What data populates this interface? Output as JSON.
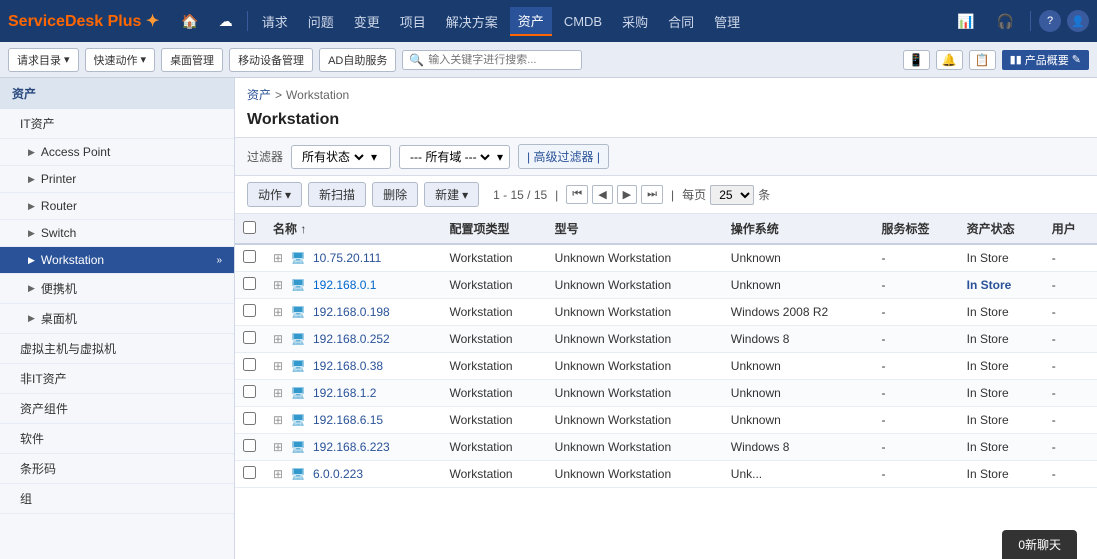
{
  "app": {
    "name": "ServiceDesk",
    "name2": "Plus",
    "logo_mark": "✦"
  },
  "topnav": {
    "icons": [
      "🏠",
      "☁",
      ""
    ],
    "items": [
      "请求",
      "问题",
      "变更",
      "项目",
      "解决方案",
      "资产",
      "CMDB",
      "采购",
      "合同",
      "管理",
      "📊",
      "🎧"
    ],
    "active": "资产",
    "right_icons": [
      "?",
      "👤"
    ]
  },
  "toolbar": {
    "btn1": "请求目录",
    "btn2": "快速动作",
    "btn3": "桌面管理",
    "btn4": "移动设备管理",
    "btn5": "AD自助服务",
    "search_placeholder": "输入关键字进行搜索...",
    "product_label": "产品概要",
    "icons": [
      "📱",
      "🔔",
      "📋"
    ]
  },
  "sidebar": {
    "main_header": "资产",
    "sections": [
      {
        "label": "IT资产",
        "id": "it-assets",
        "items": [
          {
            "label": "Access Point",
            "id": "access-point"
          },
          {
            "label": "Printer",
            "id": "printer"
          },
          {
            "label": "Router",
            "id": "router"
          },
          {
            "label": "Switch",
            "id": "switch"
          },
          {
            "label": "Workstation",
            "id": "workstation",
            "active": true
          },
          {
            "label": "便携机",
            "id": "portable"
          },
          {
            "label": "桌面机",
            "id": "desktop"
          }
        ]
      },
      {
        "label": "虚拟主机与虚拟机",
        "id": "virtual"
      },
      {
        "label": "非IT资产",
        "id": "non-it"
      },
      {
        "label": "资产组件",
        "id": "asset-components"
      },
      {
        "label": "软件",
        "id": "software"
      },
      {
        "label": "条形码",
        "id": "barcode"
      },
      {
        "label": "组",
        "id": "group"
      }
    ]
  },
  "breadcrumb": {
    "parent": "资产",
    "sep": ">",
    "current": "Workstation"
  },
  "page_title": "Workstation",
  "filter": {
    "label": "过滤器",
    "status_label": "所有状态",
    "domain_label": "--- 所有域 ---",
    "advanced_label": "| 高级过滤器 |"
  },
  "actions": {
    "action_btn": "动作",
    "scan_btn": "新扫描",
    "delete_btn": "删除",
    "new_btn": "新建",
    "pagination": "1 - 15 / 15",
    "page_per_label": "每页",
    "per_page_value": "25",
    "per_page_unit": "条"
  },
  "table": {
    "columns": [
      "",
      "名称 ↑",
      "配置项类型",
      "型号",
      "操作系统",
      "服务标签",
      "资产状态",
      "用户"
    ],
    "rows": [
      {
        "name": "10.75.20.111",
        "type": "Workstation",
        "model": "Unknown Workstation",
        "os": "Unknown",
        "service_tag": "-",
        "status": "In Store",
        "status_highlight": false,
        "user": "-"
      },
      {
        "name": "192.168.0.1",
        "type": "Workstation",
        "model": "Unknown Workstation",
        "os": "Unknown",
        "service_tag": "-",
        "status": "In Store",
        "status_highlight": true,
        "user": "-"
      },
      {
        "name": "192.168.0.198",
        "type": "Workstation",
        "model": "Unknown Workstation",
        "os": "Windows 2008 R2",
        "service_tag": "-",
        "status": "In Store",
        "status_highlight": false,
        "user": "-"
      },
      {
        "name": "192.168.0.252",
        "type": "Workstation",
        "model": "Unknown Workstation",
        "os": "Windows 8",
        "service_tag": "-",
        "status": "In Store",
        "status_highlight": false,
        "user": "-"
      },
      {
        "name": "192.168.0.38",
        "type": "Workstation",
        "model": "Unknown Workstation",
        "os": "Unknown",
        "service_tag": "-",
        "status": "In Store",
        "status_highlight": false,
        "user": "-"
      },
      {
        "name": "192.168.1.2",
        "type": "Workstation",
        "model": "Unknown Workstation",
        "os": "Unknown",
        "service_tag": "-",
        "status": "In Store",
        "status_highlight": false,
        "user": "-"
      },
      {
        "name": "192.168.6.15",
        "type": "Workstation",
        "model": "Unknown Workstation",
        "os": "Unknown",
        "service_tag": "-",
        "status": "In Store",
        "status_highlight": false,
        "user": "-"
      },
      {
        "name": "192.168.6.223",
        "type": "Workstation",
        "model": "Unknown Workstation",
        "os": "Windows 8",
        "service_tag": "-",
        "status": "In Store",
        "status_highlight": false,
        "user": "-"
      },
      {
        "name": "6.0.0.223",
        "type": "Workstation",
        "model": "Unknown Workstation",
        "os": "Unk...",
        "service_tag": "-",
        "status": "In Store",
        "status_highlight": false,
        "user": "-"
      }
    ]
  },
  "chat": {
    "label": "0新聊天"
  },
  "colors": {
    "nav_bg": "#1a3b6e",
    "active_item": "#2a5298",
    "link": "#2a5298",
    "blue_link": "#0066cc"
  }
}
